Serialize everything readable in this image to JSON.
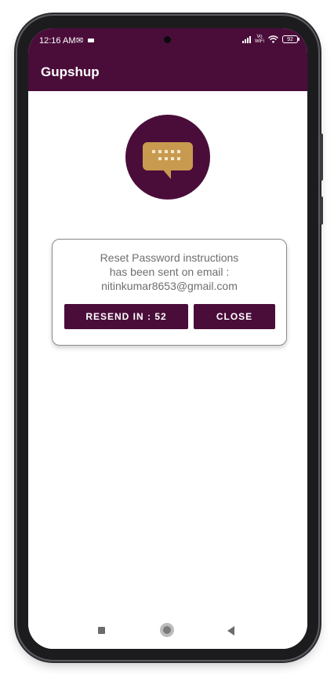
{
  "status_bar": {
    "time": "12:16 AM",
    "mail_icon": "gmail-icon",
    "video_icon": "video-camera-icon",
    "signal_icon": "signal-bars-icon",
    "vowifi_top": "Vo",
    "vowifi_bottom": "WiFi",
    "wifi_icon": "wifi-icon",
    "battery": "92"
  },
  "app_bar": {
    "title": "Gupshup"
  },
  "logo": {
    "icon": "chat-bubble-keyboard-icon"
  },
  "dialog": {
    "message_line1": "Reset Password instructions",
    "message_line2": "has been sent on email :",
    "message_line3": "nitinkumar8653@gmail.com",
    "resend_label": "RESEND IN : 52",
    "close_label": "CLOSE"
  },
  "nav_bar": {
    "recents_icon": "square-recents-icon",
    "home_icon": "circle-home-icon",
    "back_icon": "triangle-back-icon"
  },
  "colors": {
    "primary": "#4a0d3a",
    "bubble": "#c89a4f",
    "message_text": "#6e6e6e"
  }
}
